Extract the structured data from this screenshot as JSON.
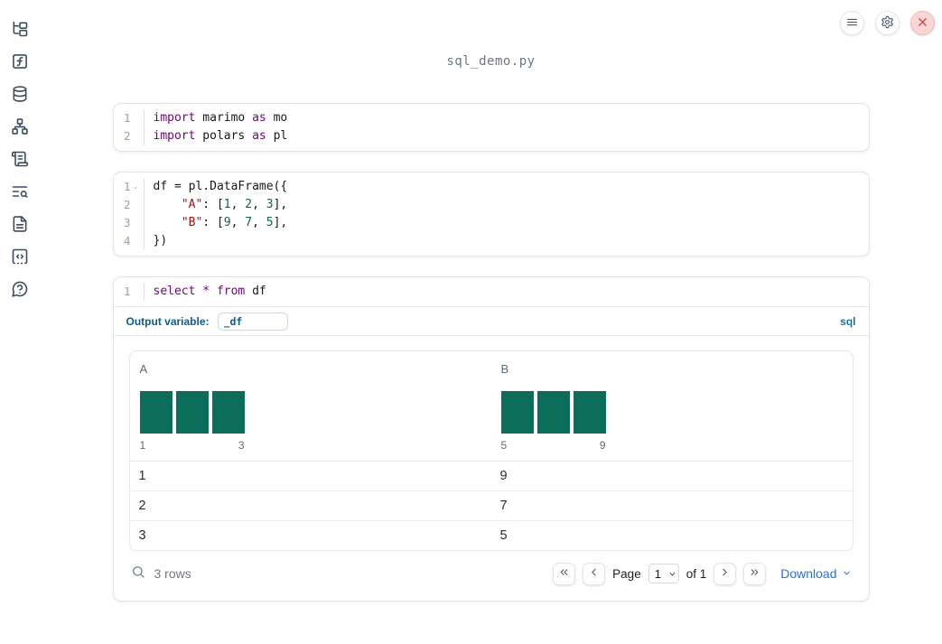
{
  "window": {
    "filename": "sql_demo.py"
  },
  "colors": {
    "icon_slate": "#3e4b5e",
    "keyword_purple": "#770088",
    "string_red": "#aa1111",
    "number_green": "#116644",
    "histogram_teal": "#0d6d5b",
    "label_blue": "#0e5c90",
    "badge_blue": "#1a6f9e",
    "accent_blue": "#2b70e0",
    "close_red": "#d14343"
  },
  "sidebar": {
    "icons": [
      "file-explorer",
      "variables",
      "datasources",
      "dependency-graph",
      "logs",
      "snippets",
      "documentation",
      "scratchpad",
      "help"
    ]
  },
  "topbar": {
    "buttons": [
      "menu",
      "settings",
      "close"
    ]
  },
  "cells": [
    {
      "lines": [
        {
          "num": "1",
          "tokens": [
            {
              "text": "import",
              "type": "kw"
            },
            {
              "text": " marimo ",
              "type": "pl"
            },
            {
              "text": "as",
              "type": "kw"
            },
            {
              "text": " mo",
              "type": "pl"
            }
          ]
        },
        {
          "num": "2",
          "tokens": [
            {
              "text": "import",
              "type": "kw"
            },
            {
              "text": " polars ",
              "type": "pl"
            },
            {
              "text": "as",
              "type": "kw"
            },
            {
              "text": " pl",
              "type": "pl"
            }
          ]
        }
      ]
    },
    {
      "lines": [
        {
          "num": "1",
          "fold": "⌄",
          "tokens": [
            {
              "text": "df = pl.DataFrame({",
              "type": "pl"
            }
          ]
        },
        {
          "num": "2",
          "tokens": [
            {
              "text": "    ",
              "type": "pl"
            },
            {
              "text": "\"A\"",
              "type": "str"
            },
            {
              "text": ": [",
              "type": "pl"
            },
            {
              "text": "1",
              "type": "num"
            },
            {
              "text": ", ",
              "type": "pl"
            },
            {
              "text": "2",
              "type": "num"
            },
            {
              "text": ", ",
              "type": "pl"
            },
            {
              "text": "3",
              "type": "num"
            },
            {
              "text": "],",
              "type": "pl"
            }
          ]
        },
        {
          "num": "3",
          "tokens": [
            {
              "text": "    ",
              "type": "pl"
            },
            {
              "text": "\"B\"",
              "type": "str"
            },
            {
              "text": ": [",
              "type": "pl"
            },
            {
              "text": "9",
              "type": "num"
            },
            {
              "text": ", ",
              "type": "pl"
            },
            {
              "text": "7",
              "type": "num"
            },
            {
              "text": ", ",
              "type": "pl"
            },
            {
              "text": "5",
              "type": "num"
            },
            {
              "text": "],",
              "type": "pl"
            }
          ]
        },
        {
          "num": "4",
          "tokens": [
            {
              "text": "})",
              "type": "pl"
            }
          ]
        }
      ]
    },
    {
      "lines": [
        {
          "num": "1",
          "tokens": [
            {
              "text": "select",
              "type": "kw"
            },
            {
              "text": " ",
              "type": "pl"
            },
            {
              "text": "*",
              "type": "kw"
            },
            {
              "text": " ",
              "type": "pl"
            },
            {
              "text": "from",
              "type": "kw"
            },
            {
              "text": " df",
              "type": "pl"
            }
          ]
        }
      ]
    }
  ],
  "sql_cell": {
    "output_variable_label": "Output variable:",
    "output_variable_value": "_df",
    "language_badge": "sql"
  },
  "table": {
    "columns": [
      {
        "name": "A",
        "histogram": {
          "bar_heights": [
            1,
            1,
            1
          ],
          "tick_labels": [
            "1",
            "3"
          ]
        }
      },
      {
        "name": "B",
        "histogram": {
          "bar_heights": [
            1,
            1,
            1
          ],
          "tick_labels": [
            "5",
            "9"
          ]
        }
      }
    ],
    "rows": [
      [
        "1",
        "9"
      ],
      [
        "2",
        "7"
      ],
      [
        "3",
        "5"
      ]
    ],
    "footer": {
      "row_count": "3 rows",
      "page_label": "Page",
      "page_value": "1",
      "page_total": "of 1",
      "download_label": "Download"
    }
  }
}
